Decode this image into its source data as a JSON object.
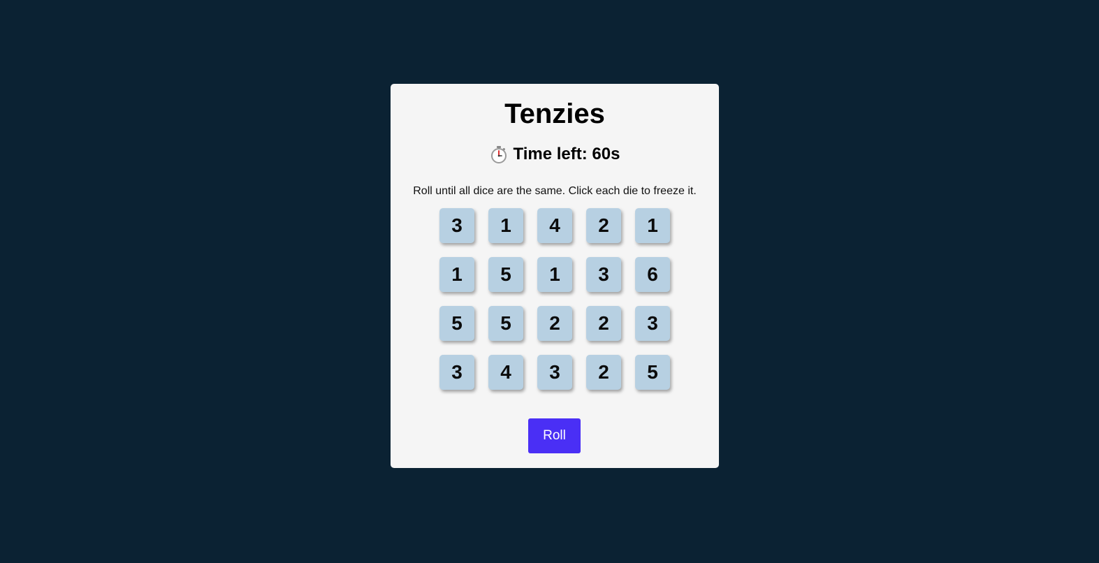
{
  "game": {
    "title": "Tenzies",
    "timer_icon": "stopwatch-icon",
    "timer_label": "Time left: 60s",
    "instructions": "Roll until all dice are the same. Click each die to freeze it.",
    "dice": [
      "3",
      "1",
      "4",
      "2",
      "1",
      "1",
      "5",
      "1",
      "3",
      "6",
      "5",
      "5",
      "2",
      "2",
      "3",
      "3",
      "4",
      "3",
      "2",
      "5"
    ],
    "roll_label": "Roll"
  },
  "colors": {
    "background": "#0b2233",
    "card": "#f5f5f5",
    "die": "#b7d0e2",
    "roll_button": "#4a2ff5"
  }
}
